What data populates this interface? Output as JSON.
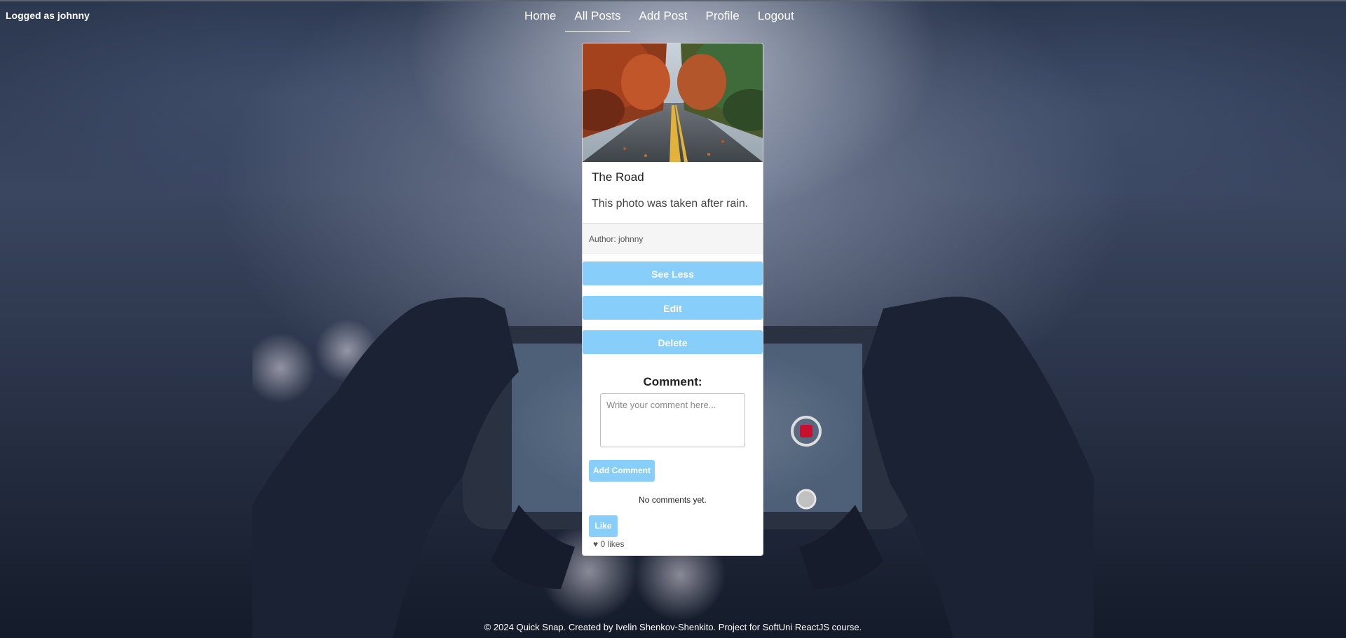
{
  "header": {
    "logged_as": "Logged as johnny",
    "nav": [
      {
        "label": "Home",
        "active": false
      },
      {
        "label": "All Posts",
        "active": true
      },
      {
        "label": "Add Post",
        "active": false
      },
      {
        "label": "Profile",
        "active": false
      },
      {
        "label": "Logout",
        "active": false
      }
    ]
  },
  "post": {
    "title": "The Road",
    "description": "This photo was taken after rain.",
    "author": "Author: johnny",
    "see_less_label": "See Less",
    "edit_label": "Edit",
    "delete_label": "Delete",
    "comment_heading": "Comment:",
    "comment_placeholder": "Write your comment here...",
    "add_comment_label": "Add Comment",
    "no_comments": "No comments yet.",
    "like_label": "Like",
    "likes": "♥ 0 likes"
  },
  "footer": {
    "text": "© 2024 Quick Snap. Created by Ivelin Shenkov-Shenkito. Project for SoftUni ReactJS course."
  },
  "colors": {
    "accent": "#87cefa",
    "card_bg": "#ffffff",
    "background": "#2c3850"
  },
  "icons": {
    "likes": "heart-icon"
  }
}
